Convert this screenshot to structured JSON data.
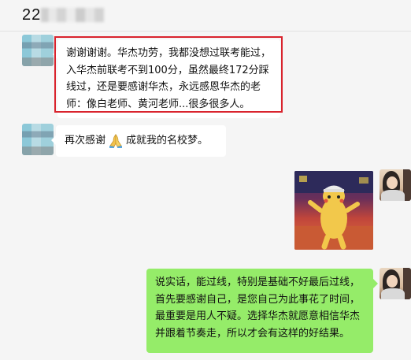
{
  "header": {
    "title": "22"
  },
  "messages": [
    {
      "side": "left",
      "text": "谢谢谢谢。华杰功劳，我都没想过联考能过，入华杰前联考不到100分，虽然最终172分踩线过，还是要感谢华杰，永远感恩华杰的老师：像白老师、黄河老师...很多很多人。",
      "highlighted": true,
      "highlight_color": "#d9232d"
    },
    {
      "side": "left",
      "text_before": "再次感谢",
      "emoji": "praying-hands-icon",
      "text_after": "成就我的名校梦。"
    },
    {
      "side": "right",
      "type": "sticker",
      "sticker": "pikachu-dancing"
    },
    {
      "side": "right",
      "text": "说实话，能过线，特别是基础不好最后过线，首先要感谢自己，是您自己为此事花了时间，最重要是用人不疑。选择华杰就愿意相信华杰并跟着节奏走，所以才会有这样的好结果。",
      "bubble_color": "#95ec69"
    }
  ],
  "colors": {
    "background": "#f5f5f5",
    "bubble_left": "#ffffff",
    "bubble_right": "#95ec69"
  }
}
